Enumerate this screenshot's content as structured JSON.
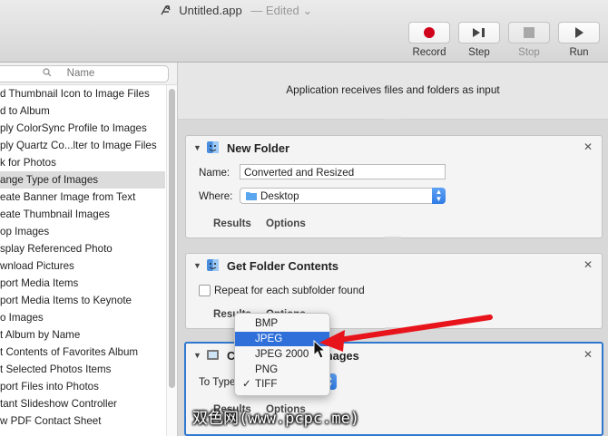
{
  "window": {
    "title": "Untitled.app",
    "edited": "— Edited"
  },
  "toolbar": {
    "record_label": "Record",
    "step_label": "Step",
    "stop_label": "Stop",
    "run_label": "Run"
  },
  "colors": {
    "accent": "#2f78d0",
    "record": "#d0021b",
    "arrow": "#e8141c",
    "menu_highlight": "#2e6fd9"
  },
  "sidebar": {
    "search_placeholder": "Name",
    "items": [
      "d Thumbnail Icon to Image Files",
      "d to Album",
      "ply ColorSync Profile to Images",
      "ply Quartz Co...lter to Image Files",
      "k for Photos",
      "ange Type of Images",
      "eate Banner Image from Text",
      "eate Thumbnail Images",
      "op Images",
      "splay Referenced Photo",
      "wnload Pictures",
      "port Media Items",
      "port Media Items to Keynote",
      "o Images",
      "t Album by Name",
      "t Contents of Favorites Album",
      "t Selected Photos Items",
      "port Files into Photos",
      "tant Slideshow Controller",
      "w PDF Contact Sheet"
    ],
    "selected_index": 5
  },
  "workflow": {
    "input_banner": "Application receives files and folders as input",
    "cards": {
      "new_folder": {
        "title": "New Folder",
        "name_label": "Name:",
        "name_value": "Converted and Resized",
        "where_label": "Where:",
        "where_value": "Desktop",
        "results_tab": "Results",
        "options_tab": "Options"
      },
      "get_folder_contents": {
        "title": "Get Folder Contents",
        "checkbox_label": "Repeat for each subfolder found",
        "results_tab": "Results",
        "options_tab": "Options"
      },
      "change_type": {
        "title_left": "C",
        "title_right": "mages",
        "to_type_label": "To Type",
        "results_tab": "Results",
        "options_tab": "Options"
      }
    },
    "type_menu": {
      "options": [
        "BMP",
        "JPEG",
        "JPEG 2000",
        "PNG",
        "TIFF"
      ],
      "highlighted": "JPEG",
      "checked": "TIFF"
    }
  },
  "watermark": "双色网(www.pcpc.me)"
}
